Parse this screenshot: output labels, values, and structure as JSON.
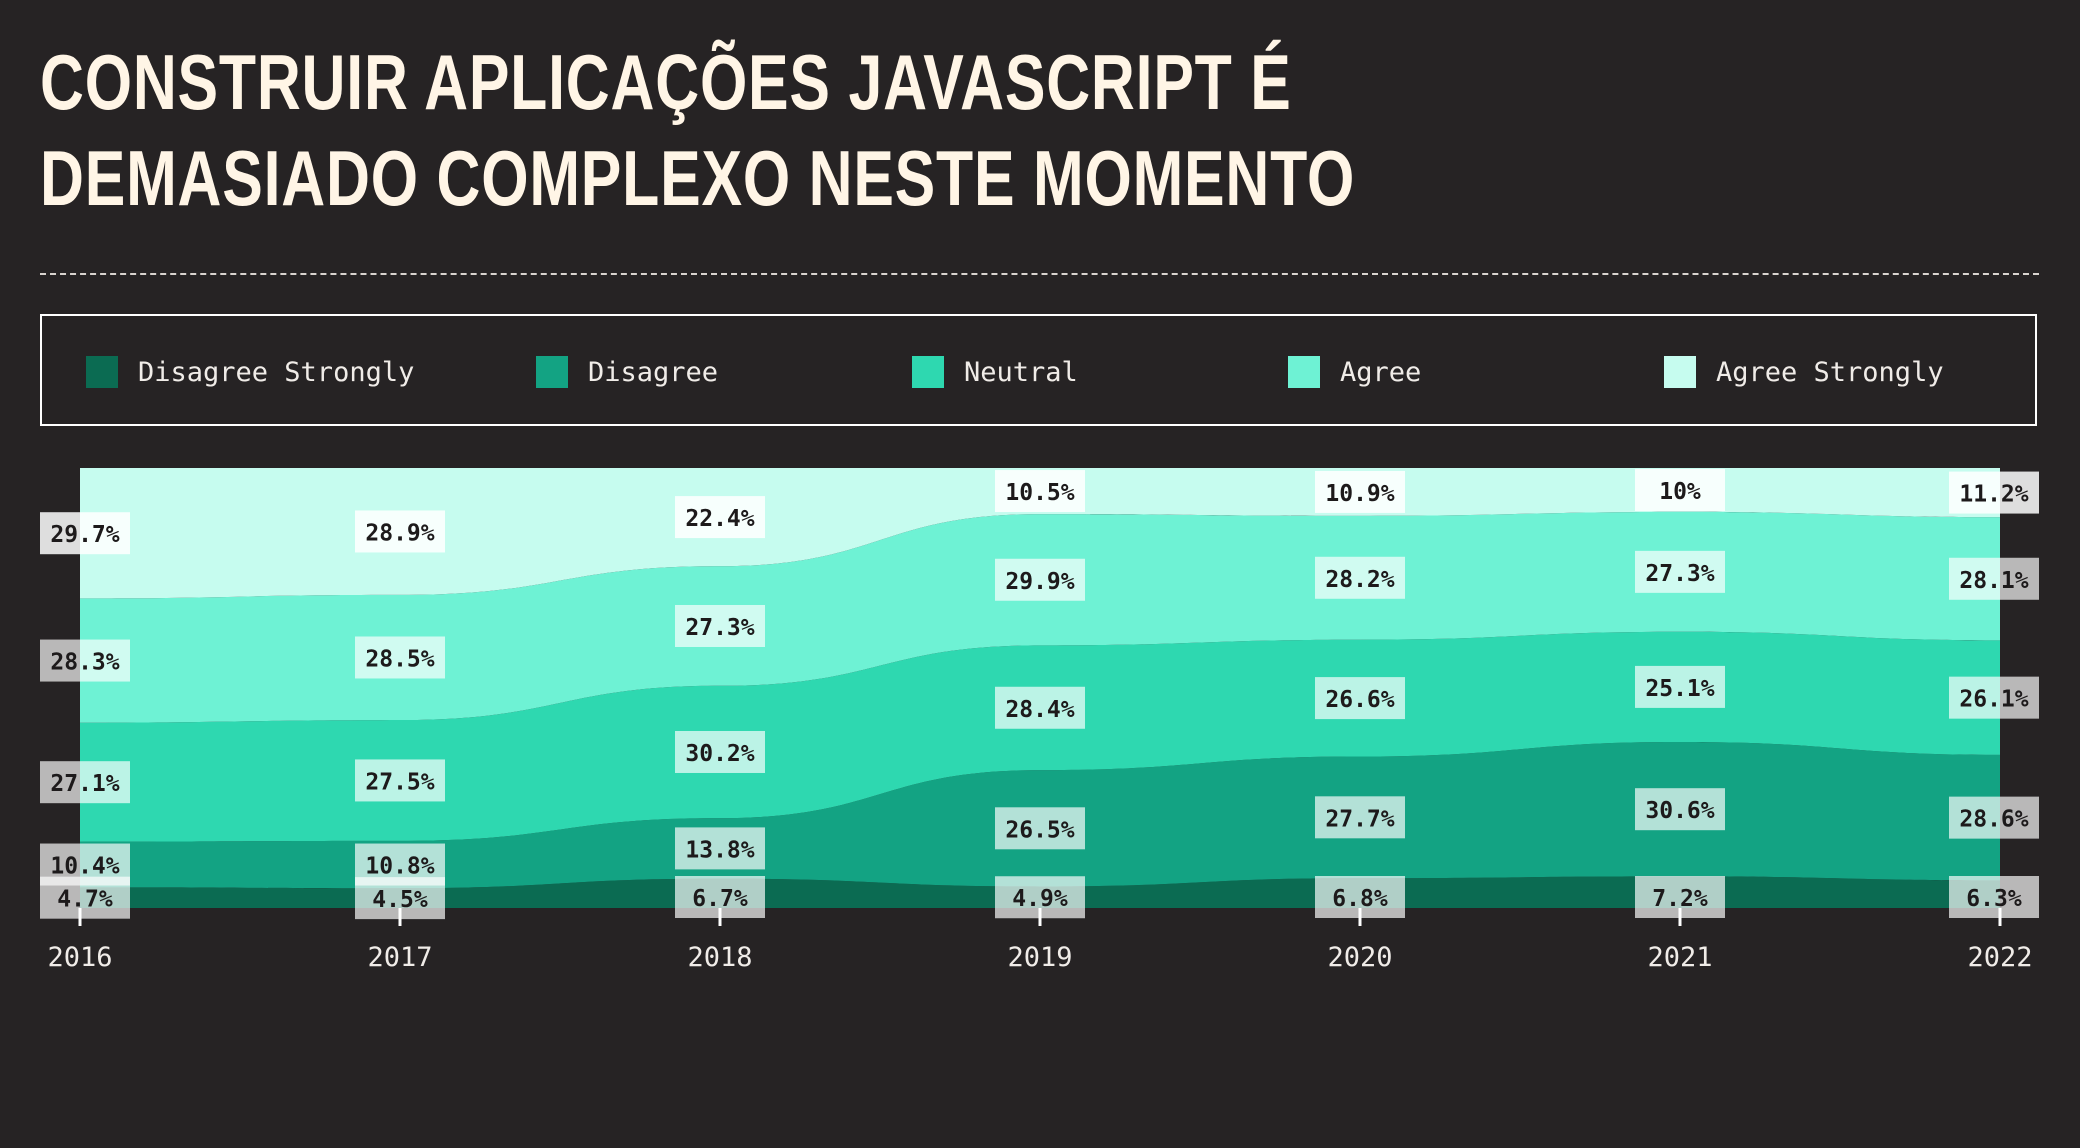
{
  "title": "CONSTRUIR APLICAÇÕES JAVASCRIPT É DEMASIADO COMPLEXO NESTE MOMENTO",
  "legend": [
    {
      "label": "Disagree Strongly",
      "color": "#0b6b52"
    },
    {
      "label": "Disagree",
      "color": "#13a383"
    },
    {
      "label": "Neutral",
      "color": "#2ed8b0"
    },
    {
      "label": "Agree",
      "color": "#6ef2d4"
    },
    {
      "label": "Agree Strongly",
      "color": "#c6fcef"
    }
  ],
  "chart_data": {
    "type": "area",
    "x": [
      "2016",
      "2017",
      "2018",
      "2019",
      "2020",
      "2021",
      "2022"
    ],
    "series": [
      {
        "name": "Disagree Strongly",
        "color": "#0b6b52",
        "values": [
          4.7,
          4.5,
          6.7,
          4.9,
          6.8,
          7.2,
          6.3
        ]
      },
      {
        "name": "Disagree",
        "color": "#13a383",
        "values": [
          10.4,
          10.8,
          13.8,
          26.5,
          27.7,
          30.6,
          28.6
        ]
      },
      {
        "name": "Neutral",
        "color": "#2ed8b0",
        "values": [
          27.1,
          27.5,
          30.2,
          28.4,
          26.6,
          25.1,
          26.1
        ]
      },
      {
        "name": "Agree",
        "color": "#6ef2d4",
        "values": [
          28.3,
          28.5,
          27.3,
          29.9,
          28.2,
          27.3,
          28.1
        ]
      },
      {
        "name": "Agree Strongly",
        "color": "#c6fcef",
        "values": [
          29.7,
          28.9,
          22.4,
          10.5,
          10.9,
          10,
          11.2
        ]
      }
    ],
    "data_labels": [
      [
        "4.7%",
        "4.5%",
        "6.7%",
        "4.9%",
        "6.8%",
        "7.2%",
        "6.3%"
      ],
      [
        "10.4%",
        "10.8%",
        "13.8%",
        "26.5%",
        "27.7%",
        "30.6%",
        "28.6%"
      ],
      [
        "27.1%",
        "27.5%",
        "30.2%",
        "28.4%",
        "26.6%",
        "25.1%",
        "26.1%"
      ],
      [
        "28.3%",
        "28.5%",
        "27.3%",
        "29.9%",
        "28.2%",
        "27.3%",
        "28.1%"
      ],
      [
        "29.7%",
        "28.9%",
        "22.4%",
        "10.5%",
        "10.9%",
        "10%",
        "11.2%"
      ]
    ],
    "stacked": true,
    "normalized": true,
    "grid": false,
    "legend_position": "top"
  }
}
